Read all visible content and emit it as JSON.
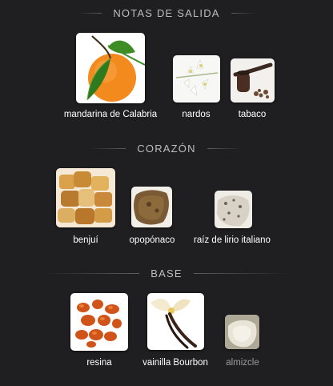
{
  "sections": {
    "top": {
      "title": "NOTAS DE SALIDA",
      "notes": [
        {
          "label": "mandarina de Calabria",
          "icon": "mandarin-image"
        },
        {
          "label": "nardos",
          "icon": "tuberose-image"
        },
        {
          "label": "tabaco",
          "icon": "tobacco-pipe-image"
        }
      ]
    },
    "heart": {
      "title": "CORAZÓN",
      "notes": [
        {
          "label": "benjuí",
          "icon": "benzoin-resin-image"
        },
        {
          "label": "opopónaco",
          "icon": "opoponax-resin-image"
        },
        {
          "label": "raíz de lirio italiano",
          "icon": "orris-root-image"
        }
      ]
    },
    "base": {
      "title": "BASE",
      "notes": [
        {
          "label": "resina",
          "icon": "resin-image"
        },
        {
          "label": "vainilla Bourbon",
          "icon": "vanilla-image"
        },
        {
          "label": "almizcle",
          "icon": "musk-image"
        }
      ]
    }
  },
  "colors": {
    "background": "#1f1f21",
    "label": "#ffffff",
    "label_dim": "#9c9c9c",
    "header": "#bdbdbd"
  }
}
